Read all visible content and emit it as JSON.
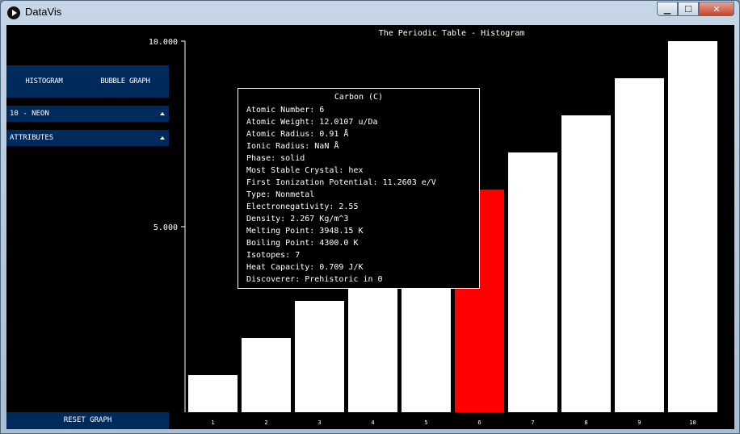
{
  "window": {
    "title": "DataVis",
    "minimize_label": "▁",
    "maximize_label": "☐",
    "close_label": "✕"
  },
  "sidebar": {
    "histogram_label": "HISTOGRAM",
    "bubble_label": "BUBBLE GRAPH",
    "element_dropdown": "10 - NEON",
    "attributes_dropdown": "ATTRIBUTES",
    "reset_label": "RESET GRAPH",
    "accent_color": "#002a5c"
  },
  "chart_data": {
    "type": "bar",
    "title": "The Periodic Table - Histogram",
    "categories": [
      "1",
      "2",
      "3",
      "4",
      "5",
      "6",
      "7",
      "8",
      "9",
      "10"
    ],
    "values": [
      1,
      2,
      3,
      4,
      5,
      6,
      7,
      8,
      9,
      10
    ],
    "ylim": [
      0,
      10
    ],
    "y_ticks": [
      "10.000",
      "5.000"
    ],
    "highlight_index": 5,
    "bar_color": "#ffffff",
    "highlight_color": "#ff0000",
    "background": "#000000"
  },
  "tooltip": {
    "title": "Carbon (C)",
    "lines": [
      "Atomic Number: 6",
      "Atomic Weight: 12.0107 u/Da",
      "Atomic Radius: 0.91 Å",
      "Ionic Radius: NaN Å",
      "Phase: solid",
      "Most Stable Crystal: hex",
      "First Ionization Potential: 11.2603 e/V",
      "Type: Nonmetal",
      "Electronegativity: 2.55",
      "Density: 2.267 Kg/m^3",
      "Melting Point: 3948.15 K",
      "Boiling Point: 4300.0 K",
      "Isotopes: 7",
      "Heat Capacity: 0.709 J/K",
      "Discoverer: Prehistoric in 0"
    ]
  }
}
